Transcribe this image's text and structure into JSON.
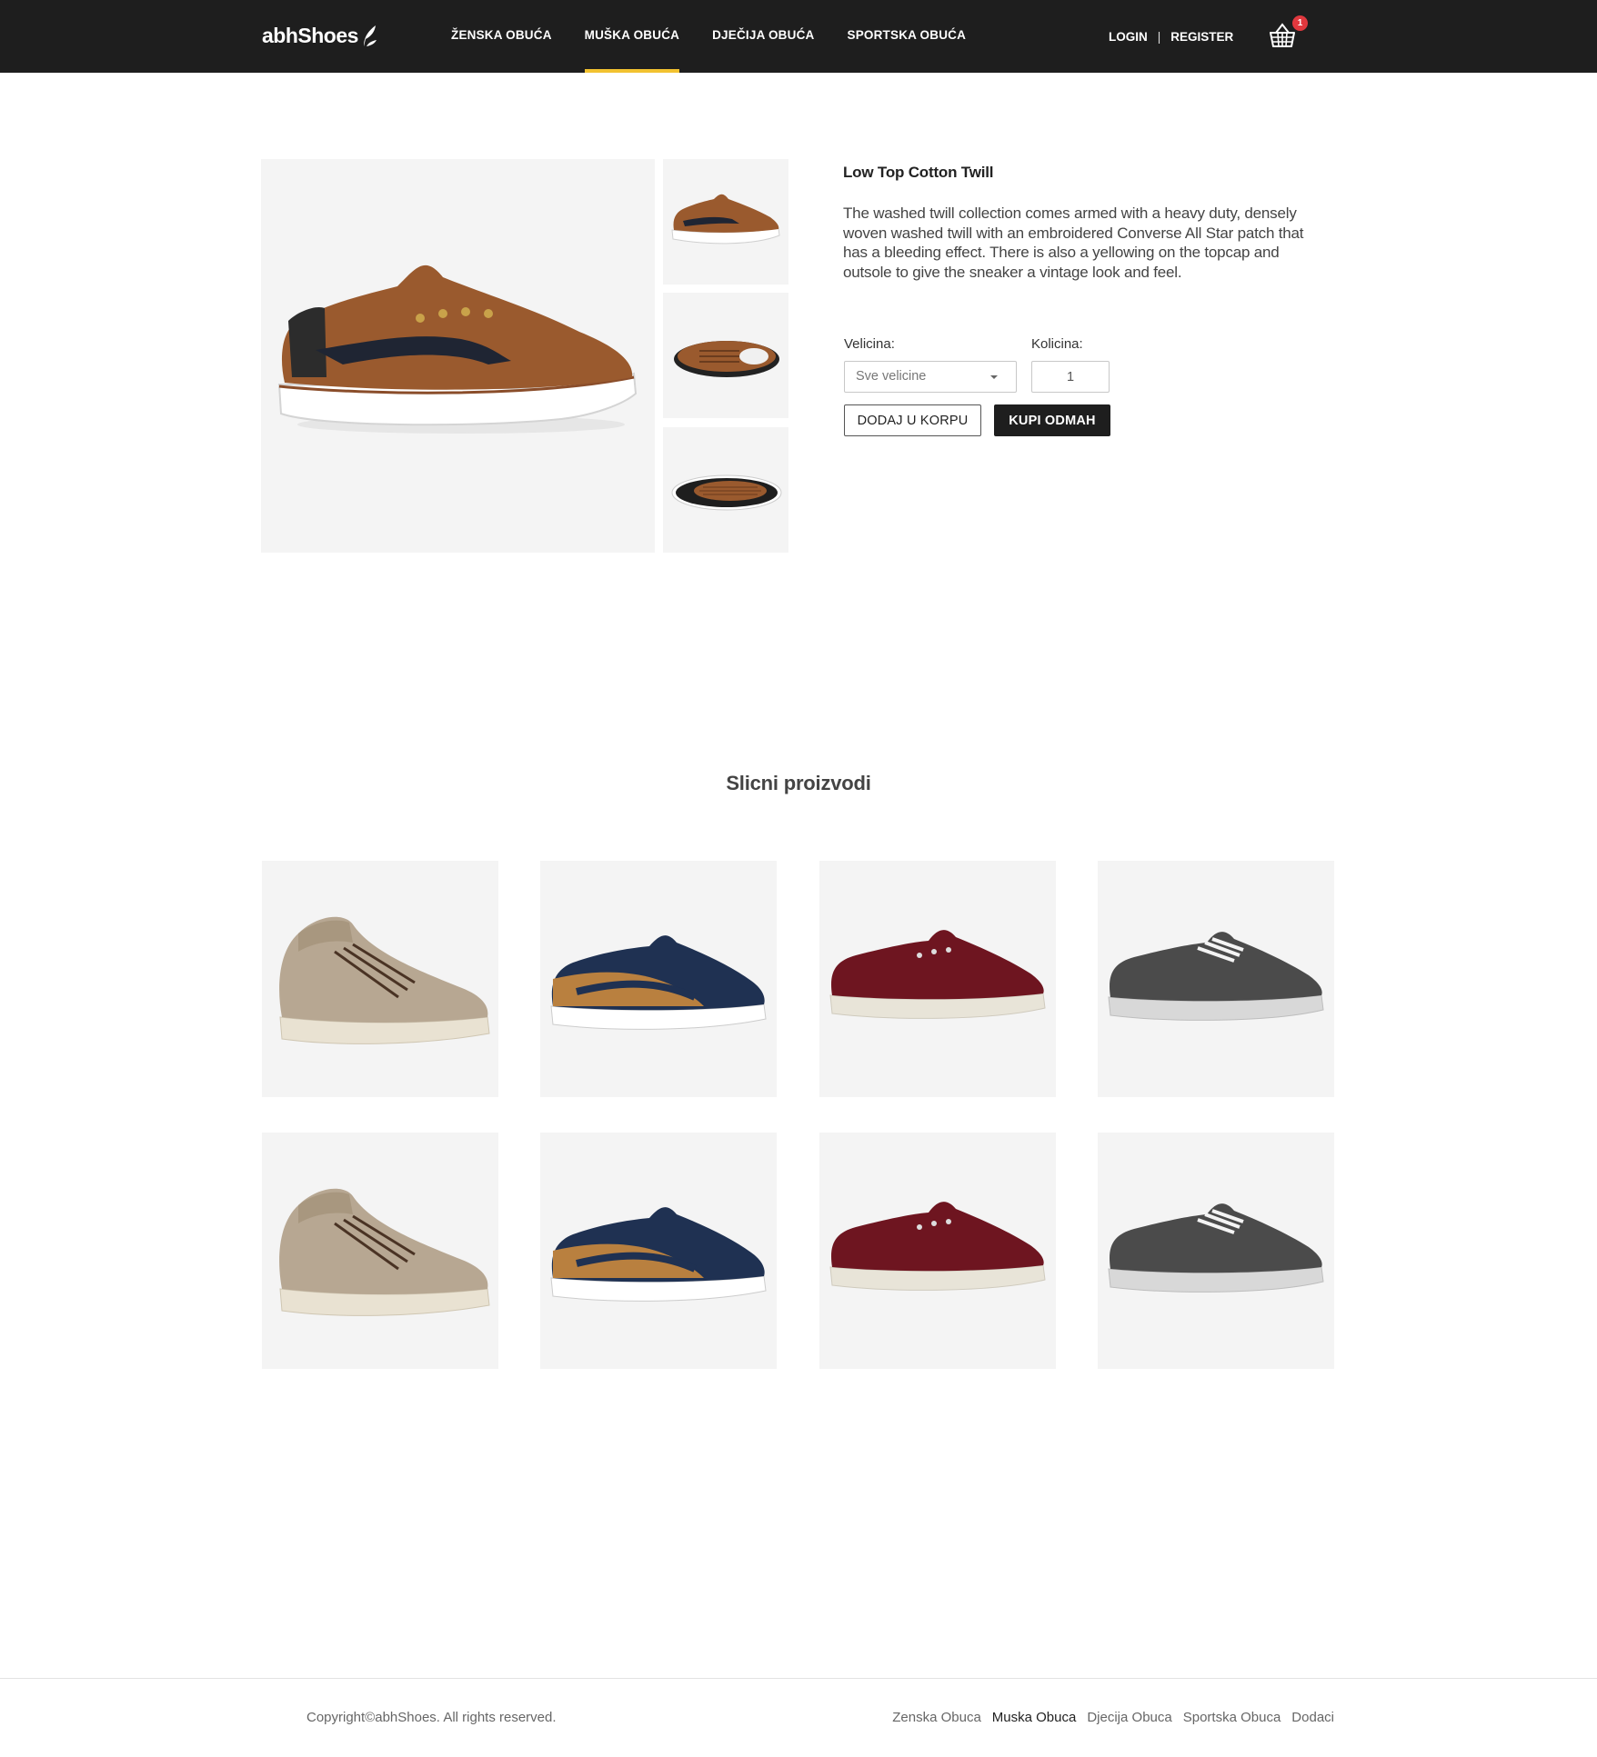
{
  "brand": {
    "name": "abhShoes"
  },
  "nav": {
    "items": [
      {
        "label": "ŽENSKA OBUĆA",
        "active": false
      },
      {
        "label": "MUŠKA OBUĆA",
        "active": true
      },
      {
        "label": "DJEČIJA OBUĆA",
        "active": false
      },
      {
        "label": "SPORTSKA OBUĆA",
        "active": false
      }
    ],
    "login": "LOGIN",
    "separator": "|",
    "register": "REGISTER",
    "cart_count": "1",
    "accent_color": "#f2c230"
  },
  "product": {
    "title": "Low Top Cotton Twill",
    "description": "The washed twill collection comes armed with a heavy duty, densely woven washed twill with an embroidered Converse All Star patch that has a bleeding effect. There is also a yellowing on the topcap and outsole to give the sneaker a vintage look and feel.",
    "size_label": "Velicina:",
    "size_value": "Sve velicine",
    "qty_label": "Kolicina:",
    "qty_value": "1",
    "add_to_cart": "DODAJ U KORPU",
    "buy_now": "KUPI ODMAH",
    "images": [
      "brown-sneaker-side",
      "brown-sneaker-top",
      "brown-sneaker-sole"
    ]
  },
  "similar": {
    "title": "Slicni proizvodi",
    "items": [
      {
        "image": "beige-high-top-sneaker"
      },
      {
        "image": "navy-tan-sneaker"
      },
      {
        "image": "burgundy-sneaker"
      },
      {
        "image": "grey-sneaker"
      },
      {
        "image": "beige-high-top-sneaker"
      },
      {
        "image": "navy-tan-sneaker"
      },
      {
        "image": "burgundy-sneaker"
      },
      {
        "image": "grey-sneaker"
      }
    ]
  },
  "footer": {
    "copyright": "Copyright©abhShoes. All rights reserved.",
    "links": [
      "Zenska Obuca",
      "Muska Obuca",
      "Djecija Obuca",
      "Sportska Obuca",
      "Dodaci"
    ],
    "current_link": "Muska Obuca"
  }
}
